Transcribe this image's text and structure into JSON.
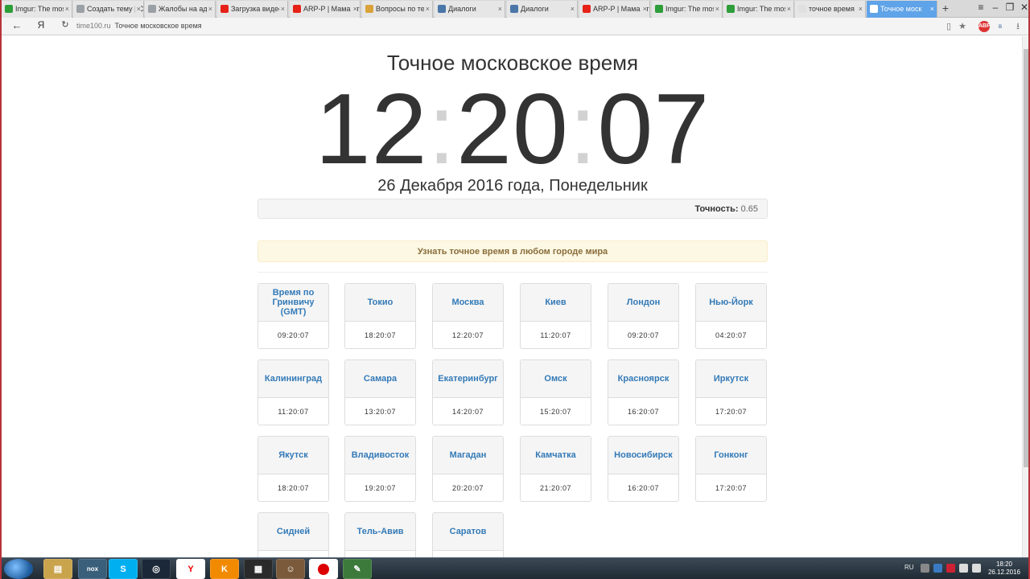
{
  "browser": {
    "tabs": [
      {
        "label": "Imgur: The most",
        "icon_color": "#2d9e3a"
      },
      {
        "label": "Создать тему | С",
        "icon_color": "#9aa0a6"
      },
      {
        "label": "Жалобы на адм",
        "icon_color": "#9aa0a6"
      },
      {
        "label": "Загрузка видео",
        "icon_color": "#e62117"
      },
      {
        "label": "ARP-P | Мама эт",
        "icon_color": "#e62117"
      },
      {
        "label": "Вопросы по тем",
        "icon_color": "#d9a33a"
      },
      {
        "label": "Диалоги",
        "icon_color": "#4a76a8"
      },
      {
        "label": "Диалоги",
        "icon_color": "#4a76a8"
      },
      {
        "label": "ARP-P | Мама эт",
        "icon_color": "#e62117"
      },
      {
        "label": "Imgur: The most",
        "icon_color": "#2d9e3a"
      },
      {
        "label": "Imgur: The most",
        "icon_color": "#2d9e3a"
      },
      {
        "label": "точное время в",
        "icon_color": "#e0e0e0"
      },
      {
        "label": "Точное моск",
        "icon_color": "#ffffff"
      }
    ],
    "address": {
      "domain": "time100.ru",
      "title": "Точное московское время",
      "yandex_label": "Я"
    }
  },
  "page": {
    "title": "Точное московское время",
    "clock": {
      "hours": "12",
      "minutes": "20",
      "seconds": "07",
      "separator": ":"
    },
    "date": "26 Декабря 2016 года, Понедельник",
    "accuracy_label": "Точность:",
    "accuracy_value": "0.65",
    "find_city_label": "Узнать точное время в любом городе мира",
    "cities": [
      {
        "name": "Время по Гринвичу (GMT)",
        "time": "09:20:07"
      },
      {
        "name": "Токио",
        "time": "18:20:07"
      },
      {
        "name": "Москва",
        "time": "12:20:07"
      },
      {
        "name": "Киев",
        "time": "11:20:07"
      },
      {
        "name": "Лондон",
        "time": "09:20:07"
      },
      {
        "name": "Нью-Йорк",
        "time": "04:20:07"
      },
      {
        "name": "Калининград",
        "time": "11:20:07"
      },
      {
        "name": "Самара",
        "time": "13:20:07"
      },
      {
        "name": "Екатеринбург",
        "time": "14:20:07"
      },
      {
        "name": "Омск",
        "time": "15:20:07"
      },
      {
        "name": "Красноярск",
        "time": "16:20:07"
      },
      {
        "name": "Иркутск",
        "time": "17:20:07"
      },
      {
        "name": "Якутск",
        "time": "18:20:07"
      },
      {
        "name": "Владивосток",
        "time": "19:20:07"
      },
      {
        "name": "Магадан",
        "time": "20:20:07"
      },
      {
        "name": "Камчатка",
        "time": "21:20:07"
      },
      {
        "name": "Новосибирск",
        "time": "16:20:07"
      },
      {
        "name": "Гонконг",
        "time": "17:20:07"
      },
      {
        "name": "Сидней",
        "time": ""
      },
      {
        "name": "Тель-Авив",
        "time": ""
      },
      {
        "name": "Саратов",
        "time": ""
      }
    ]
  },
  "taskbar": {
    "apps": [
      "explorer",
      "nox",
      "skype",
      "steam",
      "yandex",
      "k-app",
      "video",
      "game",
      "record",
      "tool"
    ],
    "app_labels": {
      "nox": "nox",
      "yandex": "Y",
      "k": "K"
    },
    "language": "RU",
    "time": "18:20",
    "date": "26.12.2016"
  },
  "colors": {
    "link": "#337ab7",
    "active_tab": "#5fa3e8",
    "warning_bg": "#fcf8e3",
    "warning_text": "#8a6d3b",
    "frame_border": "#b7333a"
  }
}
